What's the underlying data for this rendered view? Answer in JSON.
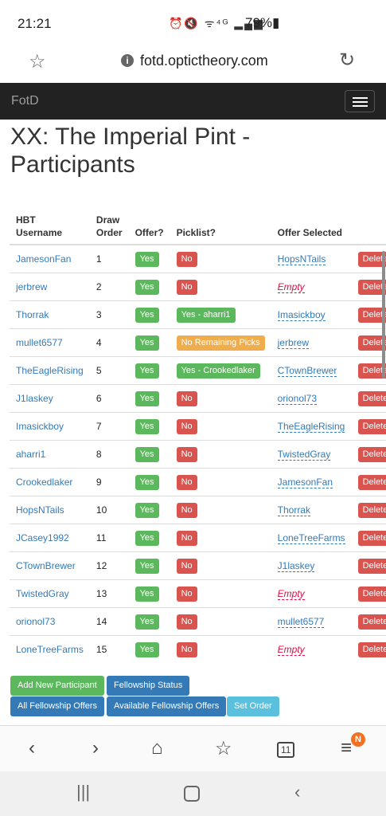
{
  "status_bar": {
    "time": "21:21",
    "icons": "⏰🔇 ᯤ⁴ᴳ ▂▄▆",
    "battery": "79%▮"
  },
  "browser": {
    "url": "fotd.optictheory.com",
    "star_icon": "☆",
    "reload_icon": "↻",
    "tab_count": "11",
    "notification_badge": "N"
  },
  "navbar": {
    "brand": "FotD"
  },
  "page": {
    "title": "XX: The Imperial Pint - Participants"
  },
  "table": {
    "headers": {
      "username": "HBT Username",
      "draw_order": "Draw Order",
      "offer": "Offer?",
      "picklist": "Picklist?",
      "offer_selected": "Offer Selected"
    },
    "rows": [
      {
        "username": "JamesonFan",
        "draw_order": "1",
        "offer": "Yes",
        "picklist": "No",
        "picklist_color": "red",
        "offer_selected": "HopsNTails",
        "offer_empty": false,
        "delete": "Delete"
      },
      {
        "username": "jerbrew",
        "draw_order": "2",
        "offer": "Yes",
        "picklist": "No",
        "picklist_color": "red",
        "offer_selected": "Empty",
        "offer_empty": true,
        "delete": "Delete"
      },
      {
        "username": "Thorrak",
        "draw_order": "3",
        "offer": "Yes",
        "picklist": "Yes - aharri1",
        "picklist_color": "green",
        "offer_selected": "Imasickboy",
        "offer_empty": false,
        "delete": "Delete"
      },
      {
        "username": "mullet6577",
        "draw_order": "4",
        "offer": "Yes",
        "picklist": "No Remaining Picks",
        "picklist_color": "orange",
        "offer_selected": "jerbrew",
        "offer_empty": false,
        "delete": "Delete"
      },
      {
        "username": "TheEagleRising",
        "draw_order": "5",
        "offer": "Yes",
        "picklist": "Yes - Crookedlaker",
        "picklist_color": "green",
        "offer_selected": "CTownBrewer",
        "offer_empty": false,
        "delete": "Delete"
      },
      {
        "username": "J1laskey",
        "draw_order": "6",
        "offer": "Yes",
        "picklist": "No",
        "picklist_color": "red",
        "offer_selected": "orionol73",
        "offer_empty": false,
        "delete": "Delete"
      },
      {
        "username": "Imasickboy",
        "draw_order": "7",
        "offer": "Yes",
        "picklist": "No",
        "picklist_color": "red",
        "offer_selected": "TheEagleRising",
        "offer_empty": false,
        "delete": "Delete"
      },
      {
        "username": "aharri1",
        "draw_order": "8",
        "offer": "Yes",
        "picklist": "No",
        "picklist_color": "red",
        "offer_selected": "TwistedGray",
        "offer_empty": false,
        "delete": "Delete"
      },
      {
        "username": "Crookedlaker",
        "draw_order": "9",
        "offer": "Yes",
        "picklist": "No",
        "picklist_color": "red",
        "offer_selected": "JamesonFan",
        "offer_empty": false,
        "delete": "Delete"
      },
      {
        "username": "HopsNTails",
        "draw_order": "10",
        "offer": "Yes",
        "picklist": "No",
        "picklist_color": "red",
        "offer_selected": "Thorrak",
        "offer_empty": false,
        "delete": "Delete"
      },
      {
        "username": "JCasey1992",
        "draw_order": "11",
        "offer": "Yes",
        "picklist": "No",
        "picklist_color": "red",
        "offer_selected": "LoneTreeFarms",
        "offer_empty": false,
        "delete": "Delete"
      },
      {
        "username": "CTownBrewer",
        "draw_order": "12",
        "offer": "Yes",
        "picklist": "No",
        "picklist_color": "red",
        "offer_selected": "J1laskey",
        "offer_empty": false,
        "delete": "Delete"
      },
      {
        "username": "TwistedGray",
        "draw_order": "13",
        "offer": "Yes",
        "picklist": "No",
        "picklist_color": "red",
        "offer_selected": "Empty",
        "offer_empty": true,
        "delete": "Delete"
      },
      {
        "username": "orionol73",
        "draw_order": "14",
        "offer": "Yes",
        "picklist": "No",
        "picklist_color": "red",
        "offer_selected": "mullet6577",
        "offer_empty": false,
        "delete": "Delete"
      },
      {
        "username": "LoneTreeFarms",
        "draw_order": "15",
        "offer": "Yes",
        "picklist": "No",
        "picklist_color": "red",
        "offer_selected": "Empty",
        "offer_empty": true,
        "delete": "Delete"
      }
    ]
  },
  "actions": {
    "add_participant": "Add New Participant",
    "fellowship_status": "Fellowship Status",
    "all_offers": "All Fellowship Offers",
    "available_offers": "Available Fellowship Offers",
    "set_order": "Set Order"
  },
  "colors": {
    "navbar_bg": "#222222",
    "success": "#5cb85c",
    "danger": "#d9534f",
    "warning": "#f0ad4e",
    "primary": "#337ab7",
    "info": "#5bc0de"
  }
}
